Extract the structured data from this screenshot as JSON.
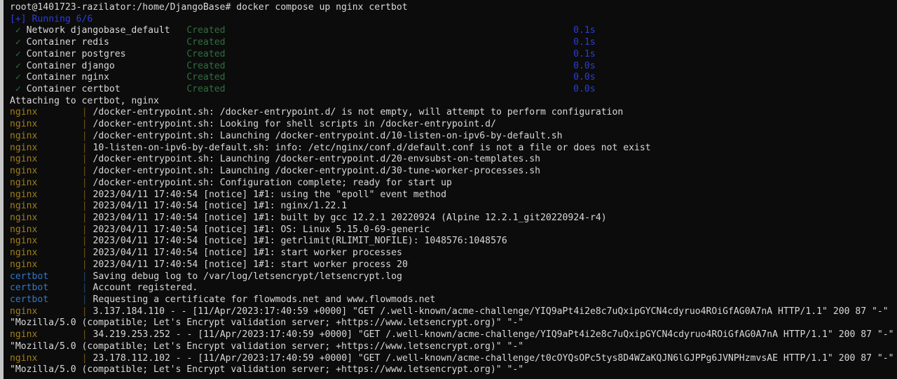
{
  "terminal": {
    "background_color": "#0c0c0c",
    "foreground_color": "#d9d9d9",
    "window_gutter_color": "#c6c6c6",
    "colors": {
      "blue": "#2a3fd6",
      "green": "#2f6f3e",
      "nginx_prefix": "#a07f1b",
      "certbot_prefix": "#3477c4",
      "nginx_pipe": "#6f5712",
      "certbot_pipe": "#23456f"
    },
    "prompt": {
      "user_host_path": "root@1401723-razilator:/home/DjangoBase#",
      "command": "docker compose up nginx certbot"
    },
    "compose_status": {
      "marker": "[+]",
      "label": "Running",
      "progress": "6/6"
    },
    "compose_steps": [
      {
        "check": "✓",
        "name": "Network djangobase_default",
        "state": "Created",
        "time": "0.1s"
      },
      {
        "check": "✓",
        "name": "Container redis",
        "state": "Created",
        "time": "0.1s"
      },
      {
        "check": "✓",
        "name": "Container postgres",
        "state": "Created",
        "time": "0.1s"
      },
      {
        "check": "✓",
        "name": "Container django",
        "state": "Created",
        "time": "0.0s"
      },
      {
        "check": "✓",
        "name": "Container nginx",
        "state": "Created",
        "time": "0.0s"
      },
      {
        "check": "✓",
        "name": "Container certbot",
        "state": "Created",
        "time": "0.0s"
      }
    ],
    "attaching_line": "Attaching to certbot, nginx",
    "log_lines": [
      {
        "service": "nginx",
        "pipe": "|",
        "text": "/docker-entrypoint.sh: /docker-entrypoint.d/ is not empty, will attempt to perform configuration"
      },
      {
        "service": "nginx",
        "pipe": "|",
        "text": "/docker-entrypoint.sh: Looking for shell scripts in /docker-entrypoint.d/"
      },
      {
        "service": "nginx",
        "pipe": "|",
        "text": "/docker-entrypoint.sh: Launching /docker-entrypoint.d/10-listen-on-ipv6-by-default.sh"
      },
      {
        "service": "nginx",
        "pipe": "|",
        "text": "10-listen-on-ipv6-by-default.sh: info: /etc/nginx/conf.d/default.conf is not a file or does not exist"
      },
      {
        "service": "nginx",
        "pipe": "|",
        "text": "/docker-entrypoint.sh: Launching /docker-entrypoint.d/20-envsubst-on-templates.sh"
      },
      {
        "service": "nginx",
        "pipe": "|",
        "text": "/docker-entrypoint.sh: Launching /docker-entrypoint.d/30-tune-worker-processes.sh"
      },
      {
        "service": "nginx",
        "pipe": "|",
        "text": "/docker-entrypoint.sh: Configuration complete; ready for start up"
      },
      {
        "service": "nginx",
        "pipe": "|",
        "text": "2023/04/11 17:40:54 [notice] 1#1: using the \"epoll\" event method"
      },
      {
        "service": "nginx",
        "pipe": "|",
        "text": "2023/04/11 17:40:54 [notice] 1#1: nginx/1.22.1"
      },
      {
        "service": "nginx",
        "pipe": "|",
        "text": "2023/04/11 17:40:54 [notice] 1#1: built by gcc 12.2.1 20220924 (Alpine 12.2.1_git20220924-r4)"
      },
      {
        "service": "nginx",
        "pipe": "|",
        "text": "2023/04/11 17:40:54 [notice] 1#1: OS: Linux 5.15.0-69-generic"
      },
      {
        "service": "nginx",
        "pipe": "|",
        "text": "2023/04/11 17:40:54 [notice] 1#1: getrlimit(RLIMIT_NOFILE): 1048576:1048576"
      },
      {
        "service": "nginx",
        "pipe": "|",
        "text": "2023/04/11 17:40:54 [notice] 1#1: start worker processes"
      },
      {
        "service": "nginx",
        "pipe": "|",
        "text": "2023/04/11 17:40:54 [notice] 1#1: start worker process 20"
      },
      {
        "service": "certbot",
        "pipe": "|",
        "text": "Saving debug log to /var/log/letsencrypt/letsencrypt.log"
      },
      {
        "service": "certbot",
        "pipe": "|",
        "text": "Account registered."
      },
      {
        "service": "certbot",
        "pipe": "|",
        "text": "Requesting a certificate for flowmods.net and www.flowmods.net"
      },
      {
        "service": "nginx",
        "pipe": "|",
        "wrapped": true,
        "text": "3.137.184.110 - - [11/Apr/2023:17:40:59 +0000] \"GET /.well-known/acme-challenge/YIQ9aPt4i2e8c7uQxipGYCN4cdyruo4ROiGfAG0A7nA HTTP/1.1\" 200 87 \"-\" \"Mozilla/5.0 (compatible; Let's Encrypt validation server; +https://www.letsencrypt.org)\" \"-\""
      },
      {
        "service": "nginx",
        "pipe": "|",
        "wrapped": true,
        "text": "34.219.253.252 - - [11/Apr/2023:17:40:59 +0000] \"GET /.well-known/acme-challenge/YIQ9aPt4i2e8c7uQxipGYCN4cdyruo4ROiGfAG0A7nA HTTP/1.1\" 200 87 \"-\" \"Mozilla/5.0 (compatible; Let's Encrypt validation server; +https://www.letsencrypt.org)\" \"-\""
      },
      {
        "service": "nginx",
        "pipe": "|",
        "wrapped": true,
        "text": "23.178.112.102 - - [11/Apr/2023:17:40:59 +0000] \"GET /.well-known/acme-challenge/t0cOYQsOPc5tys8D4WZaKQJN6lGJPPg6JVNPHzmvsAE HTTP/1.1\" 200 87 \"-\" \"Mozilla/5.0 (compatible; Let's Encrypt validation server; +https://www.letsencrypt.org)\" \"-\""
      }
    ]
  }
}
